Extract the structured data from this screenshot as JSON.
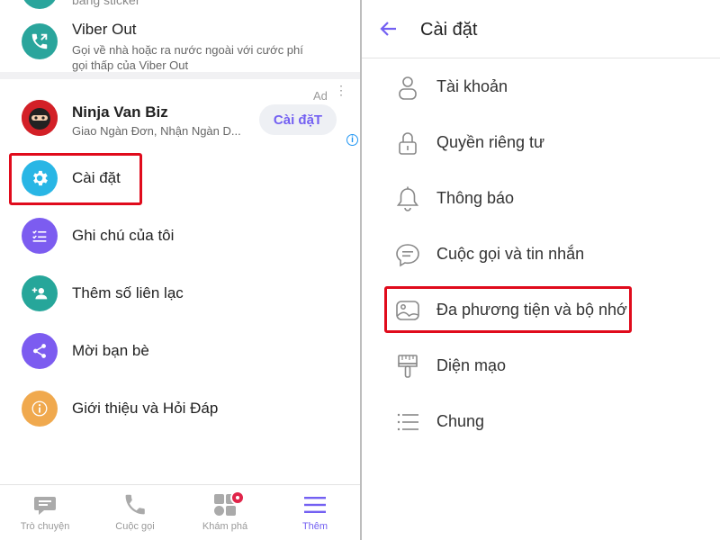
{
  "left": {
    "partial_top_text": "bằng sticker",
    "viber_out": {
      "title": "Viber Out",
      "line1": "Gọi về nhà hoặc ra nước ngoài với cước phí",
      "line2": "gọi thấp của Viber Out"
    },
    "ad": {
      "title": "Ninja Van Biz",
      "subtitle": "Giao Ngàn Đơn, Nhận Ngàn D...",
      "label": "Ad",
      "dots": "⋮",
      "button": "Cài đặT",
      "info": "i"
    },
    "menu": [
      {
        "label": "Cài đặt",
        "icon": "gear-icon",
        "color": "#29b6e5"
      },
      {
        "label": "Ghi chú của tôi",
        "icon": "checklist-icon",
        "color": "#7c5cf0"
      },
      {
        "label": "Thêm số liên lạc",
        "icon": "add-contact-icon",
        "color": "#26a69a"
      },
      {
        "label": "Mời bạn bè",
        "icon": "share-icon",
        "color": "#7c5cf0"
      },
      {
        "label": "Giới thiệu và Hỏi Đáp",
        "icon": "info-icon",
        "color": "#f0a94e"
      }
    ],
    "bottom_nav": [
      {
        "label": "Trò chuyện",
        "icon": "chat-icon"
      },
      {
        "label": "Cuộc gọi",
        "icon": "phone-icon"
      },
      {
        "label": "Khám phá",
        "icon": "explore-icon"
      },
      {
        "label": "Thêm",
        "icon": "menu-icon",
        "active": true
      }
    ]
  },
  "right": {
    "title": "Cài đặt",
    "items": [
      {
        "label": "Tài khoản",
        "icon": "account-icon"
      },
      {
        "label": "Quyền riêng tư",
        "icon": "lock-icon"
      },
      {
        "label": "Thông báo",
        "icon": "bell-icon"
      },
      {
        "label": "Cuộc gọi và tin nhắn",
        "icon": "message-icon"
      },
      {
        "label": "Đa phương tiện và bộ nhớ",
        "icon": "media-icon"
      },
      {
        "label": "Diện mạo",
        "icon": "brush-icon"
      },
      {
        "label": "Chung",
        "icon": "list-icon"
      }
    ]
  },
  "colors": {
    "accent": "#7360f2",
    "highlight": "#e00b1c",
    "viber_out": "#2aa59c"
  }
}
